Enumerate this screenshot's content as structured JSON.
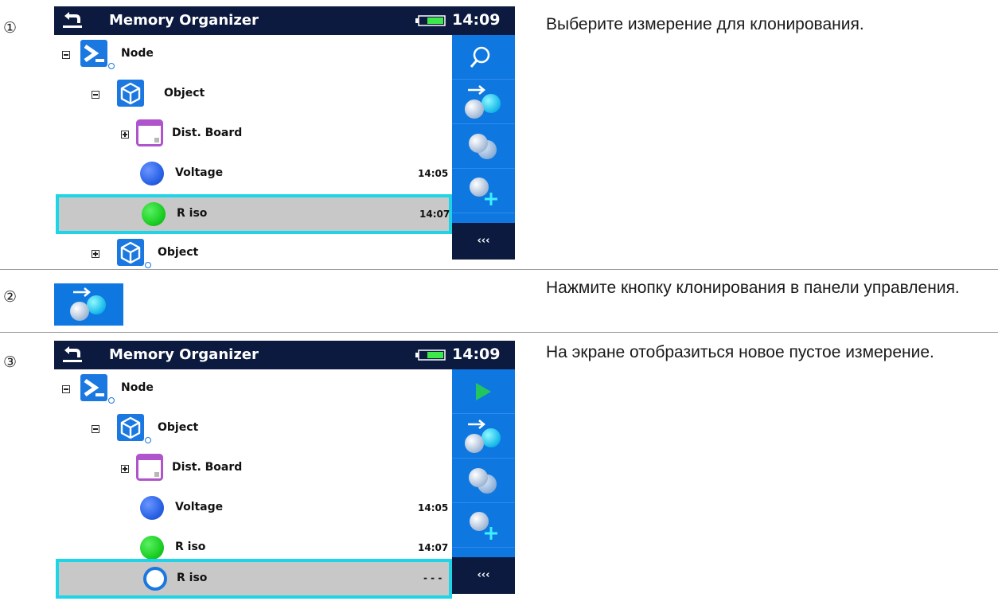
{
  "steps": [
    {
      "number": "①",
      "instruction": "Выберите измерение для клонирования."
    },
    {
      "number": "②",
      "instruction": "Нажмите кнопку клонирования в панели управления."
    },
    {
      "number": "③",
      "instruction": "На экране отобразиться новое пустое измерение."
    }
  ],
  "screen": {
    "title": "Memory Organizer",
    "time": "14:09",
    "more_label": "‹‹‹"
  },
  "tree": {
    "node": "Node",
    "object": "Object",
    "dist_board": "Dist. Board",
    "voltage": "Voltage",
    "voltage_time": "14:05",
    "riso": "R iso",
    "riso_time": "14:07",
    "riso_new_time": "- - -"
  },
  "colors": {
    "header": "#0b1a3e",
    "sidebar": "#0f78e0",
    "selection_border": "#1ed5e8",
    "selection_fill": "#c8c8c8",
    "voltage_dot": "#2a63e6",
    "riso_dot": "#1ccf24",
    "play": "#22c55e"
  },
  "icons": {
    "back": "back-arrow-icon",
    "battery": "battery-icon",
    "search": "search-icon",
    "clone": "clone-icon",
    "copy": "copy-measurement-icon",
    "add": "add-measurement-icon",
    "play": "play-icon"
  }
}
